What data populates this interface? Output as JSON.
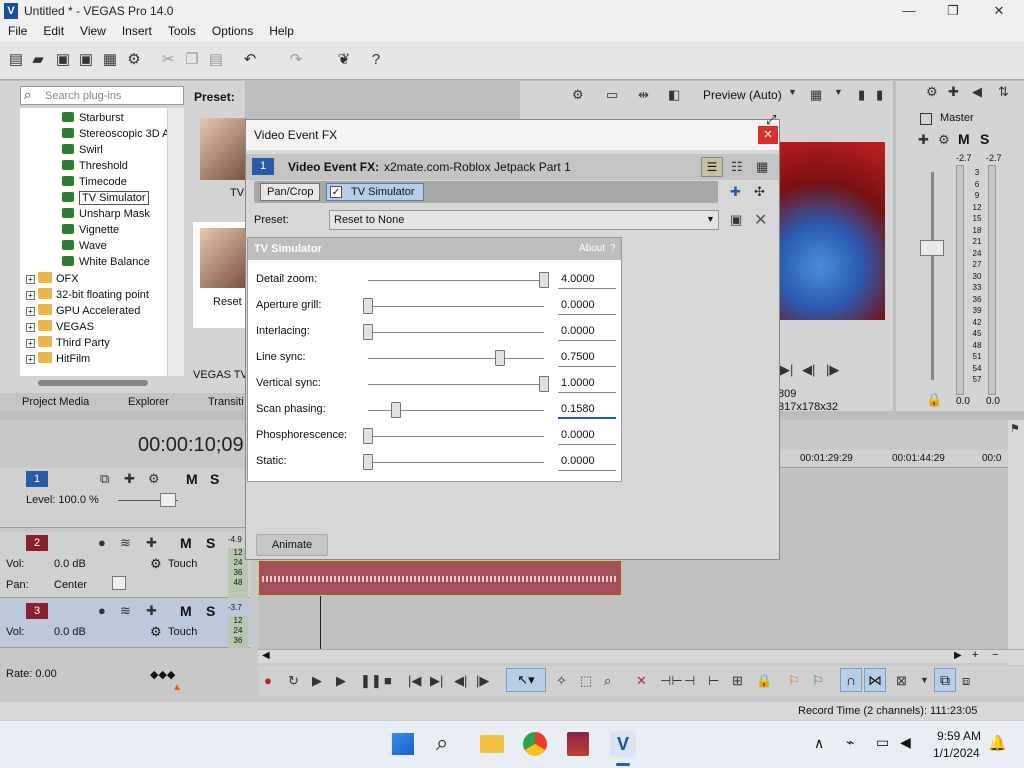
{
  "window": {
    "title": "Untitled * - VEGAS Pro 14.0",
    "minimize": "—",
    "restore": "❐",
    "close": "✕"
  },
  "menu": [
    "File",
    "Edit",
    "View",
    "Insert",
    "Tools",
    "Options",
    "Help"
  ],
  "plugins": {
    "search_placeholder": "Search plug-ins",
    "preset_label": "Preset:",
    "items": [
      "Starburst",
      "Stereoscopic 3D A",
      "Swirl",
      "Threshold",
      "Timecode",
      "TV Simulator",
      "Unsharp Mask",
      "Vignette",
      "Wave",
      "White Balance"
    ],
    "selected": "TV Simulator",
    "folders": [
      "OFX",
      "32-bit floating point",
      "GPU Accelerated",
      "VEGAS",
      "Third Party",
      "HitFilm"
    ],
    "thumb_labels": [
      "TV",
      "Reset"
    ],
    "footer_label": "VEGAS TV S"
  },
  "tabs": [
    "Project Media",
    "Explorer",
    "Transiti"
  ],
  "preview": {
    "mode": "Preview (Auto)",
    "frame": "809",
    "size": "317x178x32"
  },
  "master": {
    "label": "Master",
    "left_db": "-2.7",
    "right_db": "-2.7",
    "scale": [
      "3",
      "6",
      "9",
      "12",
      "15",
      "18",
      "21",
      "24",
      "27",
      "30",
      "33",
      "36",
      "39",
      "42",
      "45",
      "48",
      "51",
      "54",
      "57"
    ],
    "left_bottom": "0.0",
    "right_bottom": "0.0"
  },
  "dialog": {
    "title": "Video Event FX",
    "chain_label": "Video Event FX:",
    "chain_name": "x2mate.com-Roblox Jetpack Part 1",
    "track_num": "1",
    "chain_items": [
      "Pan/Crop",
      "TV Simulator"
    ],
    "preset_label": "Preset:",
    "preset_value": "Reset to None",
    "fx_name": "TV Simulator",
    "about": "About",
    "help": "?",
    "params": [
      {
        "label": "Detail zoom:",
        "value": "4.0000",
        "pos": 1.0
      },
      {
        "label": "Aperture grill:",
        "value": "0.0000",
        "pos": 0.0
      },
      {
        "label": "Interlacing:",
        "value": "0.0000",
        "pos": 0.0
      },
      {
        "label": "Line sync:",
        "value": "0.7500",
        "pos": 0.75
      },
      {
        "label": "Vertical sync:",
        "value": "1.0000",
        "pos": 1.0
      },
      {
        "label": "Scan phasing:",
        "value": "0.1580",
        "pos": 0.158
      },
      {
        "label": "Phosphorescence:",
        "value": "0.0000",
        "pos": 0.0
      },
      {
        "label": "Static:",
        "value": "0.0000",
        "pos": 0.0
      }
    ],
    "animate": "Animate"
  },
  "timeline": {
    "timecode": "00:00:10;09",
    "ruler": [
      "00:01:29:29",
      "00:01:44:29",
      "00:0"
    ],
    "track1": {
      "num": "1",
      "level": "Level: 100.0 %"
    },
    "track2": {
      "num": "2",
      "vol_label": "Vol:",
      "vol": "0.0 dB",
      "pan_label": "Pan:",
      "pan": "Center",
      "mode": "Touch",
      "meter": [
        "-4.9",
        "12",
        "24",
        "36",
        "48"
      ]
    },
    "track3": {
      "num": "3",
      "vol_label": "Vol:",
      "vol": "0.0 dB",
      "mode": "Touch",
      "meter": [
        "-3.7",
        "12",
        "24",
        "36"
      ]
    },
    "rate": "Rate: 0.00"
  },
  "status": {
    "record_time": "Record Time (2 channels): 111:23:05"
  },
  "taskbar": {
    "time": "9:59 AM",
    "date": "1/1/2024"
  }
}
